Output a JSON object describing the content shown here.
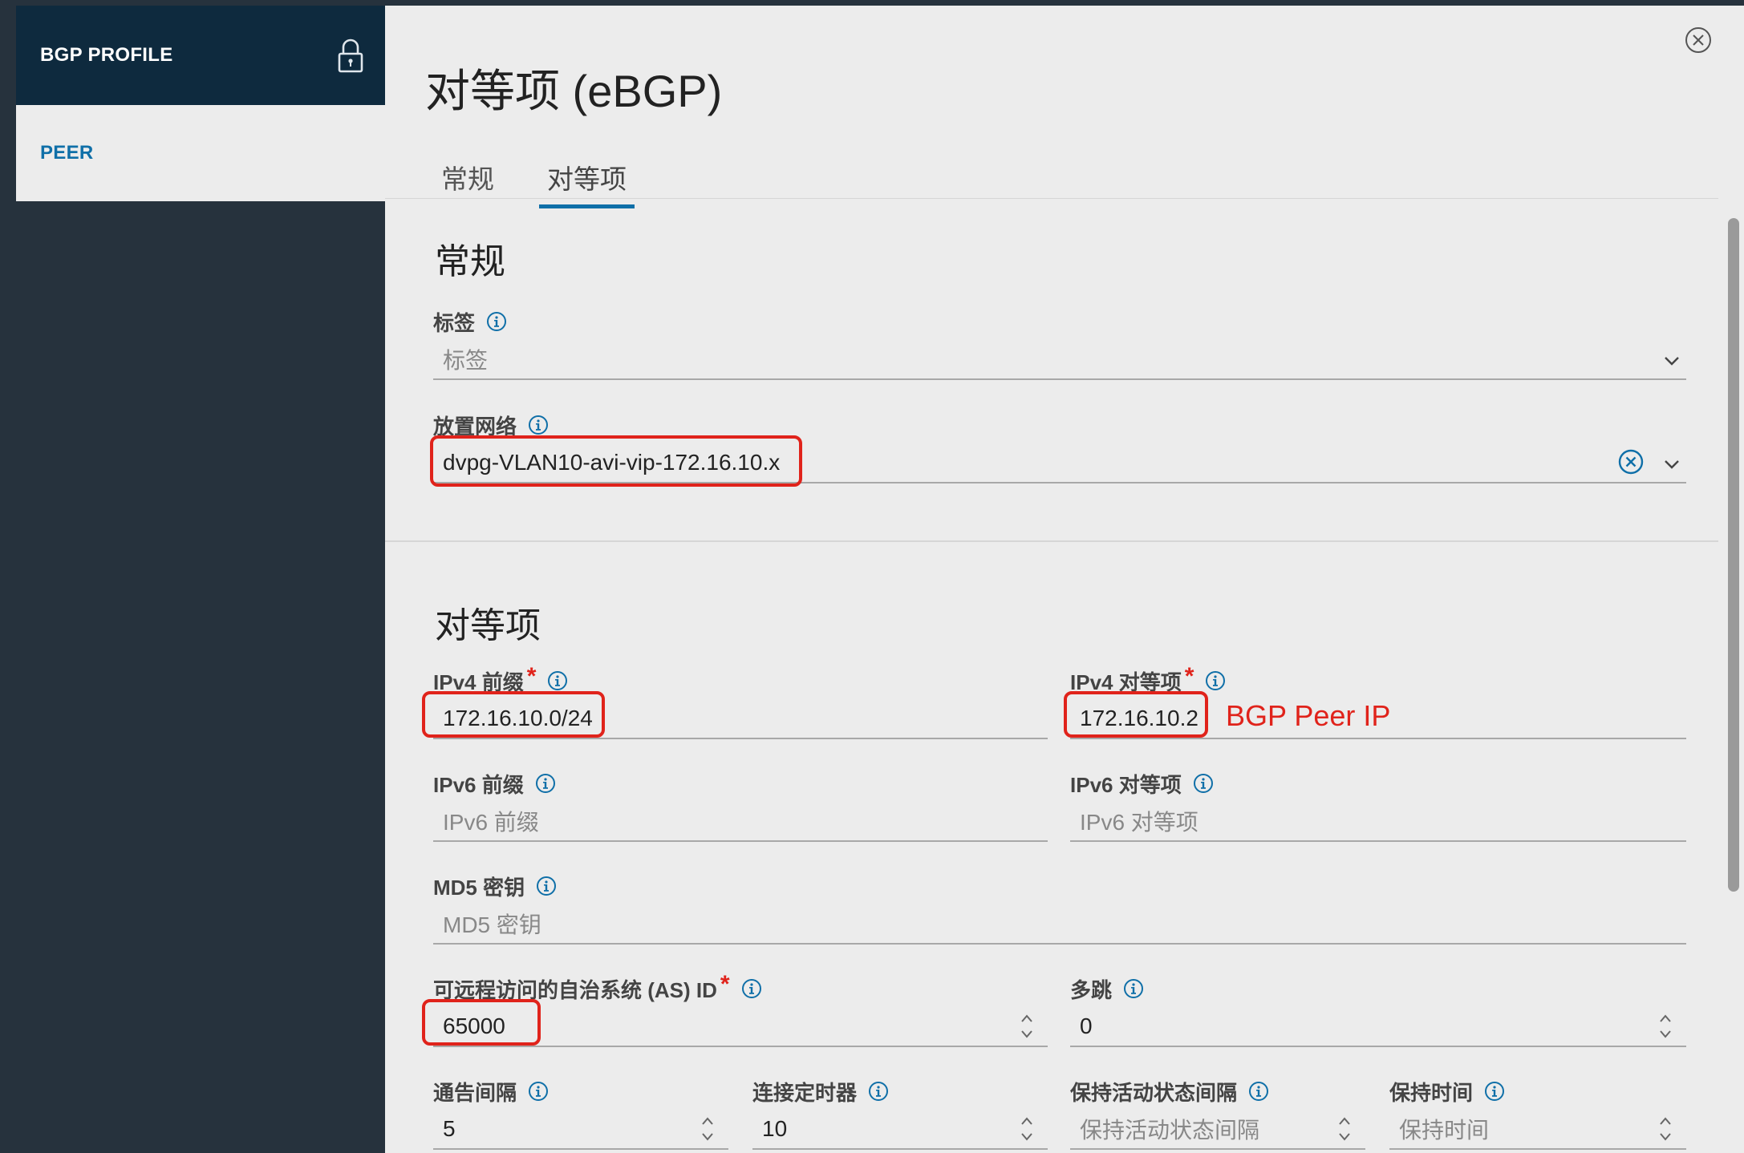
{
  "nav": {
    "profile_label": "BGP PROFILE",
    "peer_label": "PEER"
  },
  "dialog": {
    "title": "对等项 (eBGP)",
    "tabs": [
      "常规",
      "对等项"
    ],
    "active_tab": "对等项"
  },
  "general": {
    "section_title": "常规",
    "tags": {
      "label": "标签",
      "placeholder": "标签"
    },
    "placement_network": {
      "label": "放置网络",
      "value": "dvpg-VLAN10-avi-vip-172.16.10.x"
    }
  },
  "peer": {
    "section_title": "对等项",
    "ipv4_prefix": {
      "label": "IPv4 前缀",
      "value": "172.16.10.0/24"
    },
    "ipv4_peer": {
      "label": "IPv4 对等项",
      "value": "172.16.10.2"
    },
    "ipv6_prefix": {
      "label": "IPv6 前缀",
      "placeholder": "IPv6 前缀"
    },
    "ipv6_peer": {
      "label": "IPv6 对等项",
      "placeholder": "IPv6 对等项"
    },
    "md5": {
      "label": "MD5 密钥",
      "placeholder": "MD5 密钥"
    },
    "remote_as": {
      "label": "可远程访问的自治系统 (AS) ID",
      "value": "65000"
    },
    "multihop": {
      "label": "多跳",
      "value": "0"
    },
    "advertisement_interval": {
      "label": "通告间隔",
      "value": "5"
    },
    "connect_timer": {
      "label": "连接定时器",
      "value": "10"
    },
    "keepalive_interval": {
      "label": "保持活动状态间隔",
      "placeholder": "保持活动状态间隔"
    },
    "hold_time": {
      "label": "保持时间",
      "placeholder": "保持时间"
    }
  },
  "annotation": "BGP Peer IP",
  "colors": {
    "accent": "#0f6fa8",
    "highlight": "#e0231b",
    "nav_dark": "#0e2a3e"
  }
}
